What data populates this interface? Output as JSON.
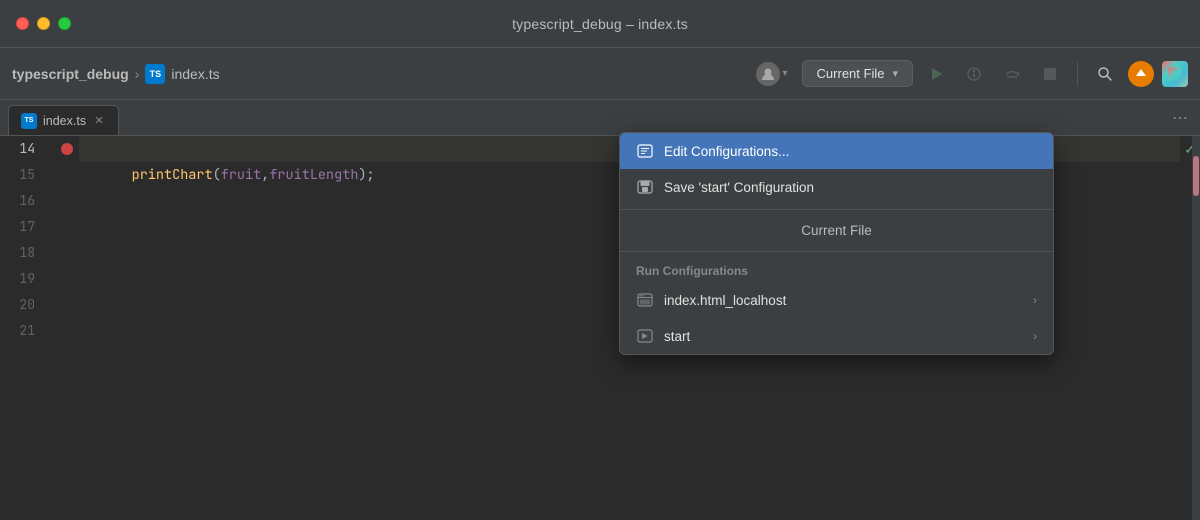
{
  "window": {
    "title": "typescript_debug – index.ts"
  },
  "traffic_lights": {
    "close": "close",
    "minimize": "minimize",
    "maximize": "maximize"
  },
  "toolbar": {
    "project_name": "typescript_debug",
    "separator": "›",
    "file_icon_label": "TS",
    "filename": "index.ts",
    "run_config_label": "Current File",
    "run_config_dropdown_arrow": "▾",
    "run_button_icon": "▶",
    "debug_button_icon": "🐛",
    "step_over_icon": "↷",
    "stop_icon": "◼",
    "search_icon": "🔍",
    "update_icon": "↑",
    "user_icon": "👤",
    "user_dropdown_arrow": "▾"
  },
  "tabs": {
    "items": [
      {
        "label": "index.ts",
        "closable": true
      }
    ],
    "overflow_icon": "⋯"
  },
  "editor": {
    "lines": [
      {
        "num": "14",
        "content": "printChart(fruit,fruitLength);",
        "has_breakpoint": true
      },
      {
        "num": "15",
        "content": ""
      },
      {
        "num": "16",
        "content": ""
      },
      {
        "num": "17",
        "content": ""
      },
      {
        "num": "18",
        "content": ""
      },
      {
        "num": "19",
        "content": ""
      },
      {
        "num": "20",
        "content": ""
      },
      {
        "num": "21",
        "content": ""
      }
    ]
  },
  "dropdown": {
    "items": [
      {
        "id": "edit-configs",
        "label": "Edit Configurations...",
        "icon": "edit",
        "selected": true,
        "has_chevron": false
      },
      {
        "id": "save-config",
        "label": "Save 'start' Configuration",
        "icon": "save",
        "selected": false,
        "has_chevron": false
      },
      {
        "id": "current-file",
        "label": "Current File",
        "icon": "",
        "selected": false,
        "has_chevron": false,
        "centered": true
      },
      {
        "id": "run-configs-header",
        "label": "Run Configurations",
        "is_header": true
      },
      {
        "id": "index-html",
        "label": "index.html_localhost",
        "icon": "browser",
        "selected": false,
        "has_chevron": true
      },
      {
        "id": "start",
        "label": "start",
        "icon": "start",
        "selected": false,
        "has_chevron": true
      }
    ]
  },
  "colors": {
    "accent_blue": "#4375b8",
    "breakpoint_red": "#cc4444",
    "check_green": "#6aab73",
    "bg_editor": "#2b2b2b",
    "bg_toolbar": "#3c3f41"
  }
}
